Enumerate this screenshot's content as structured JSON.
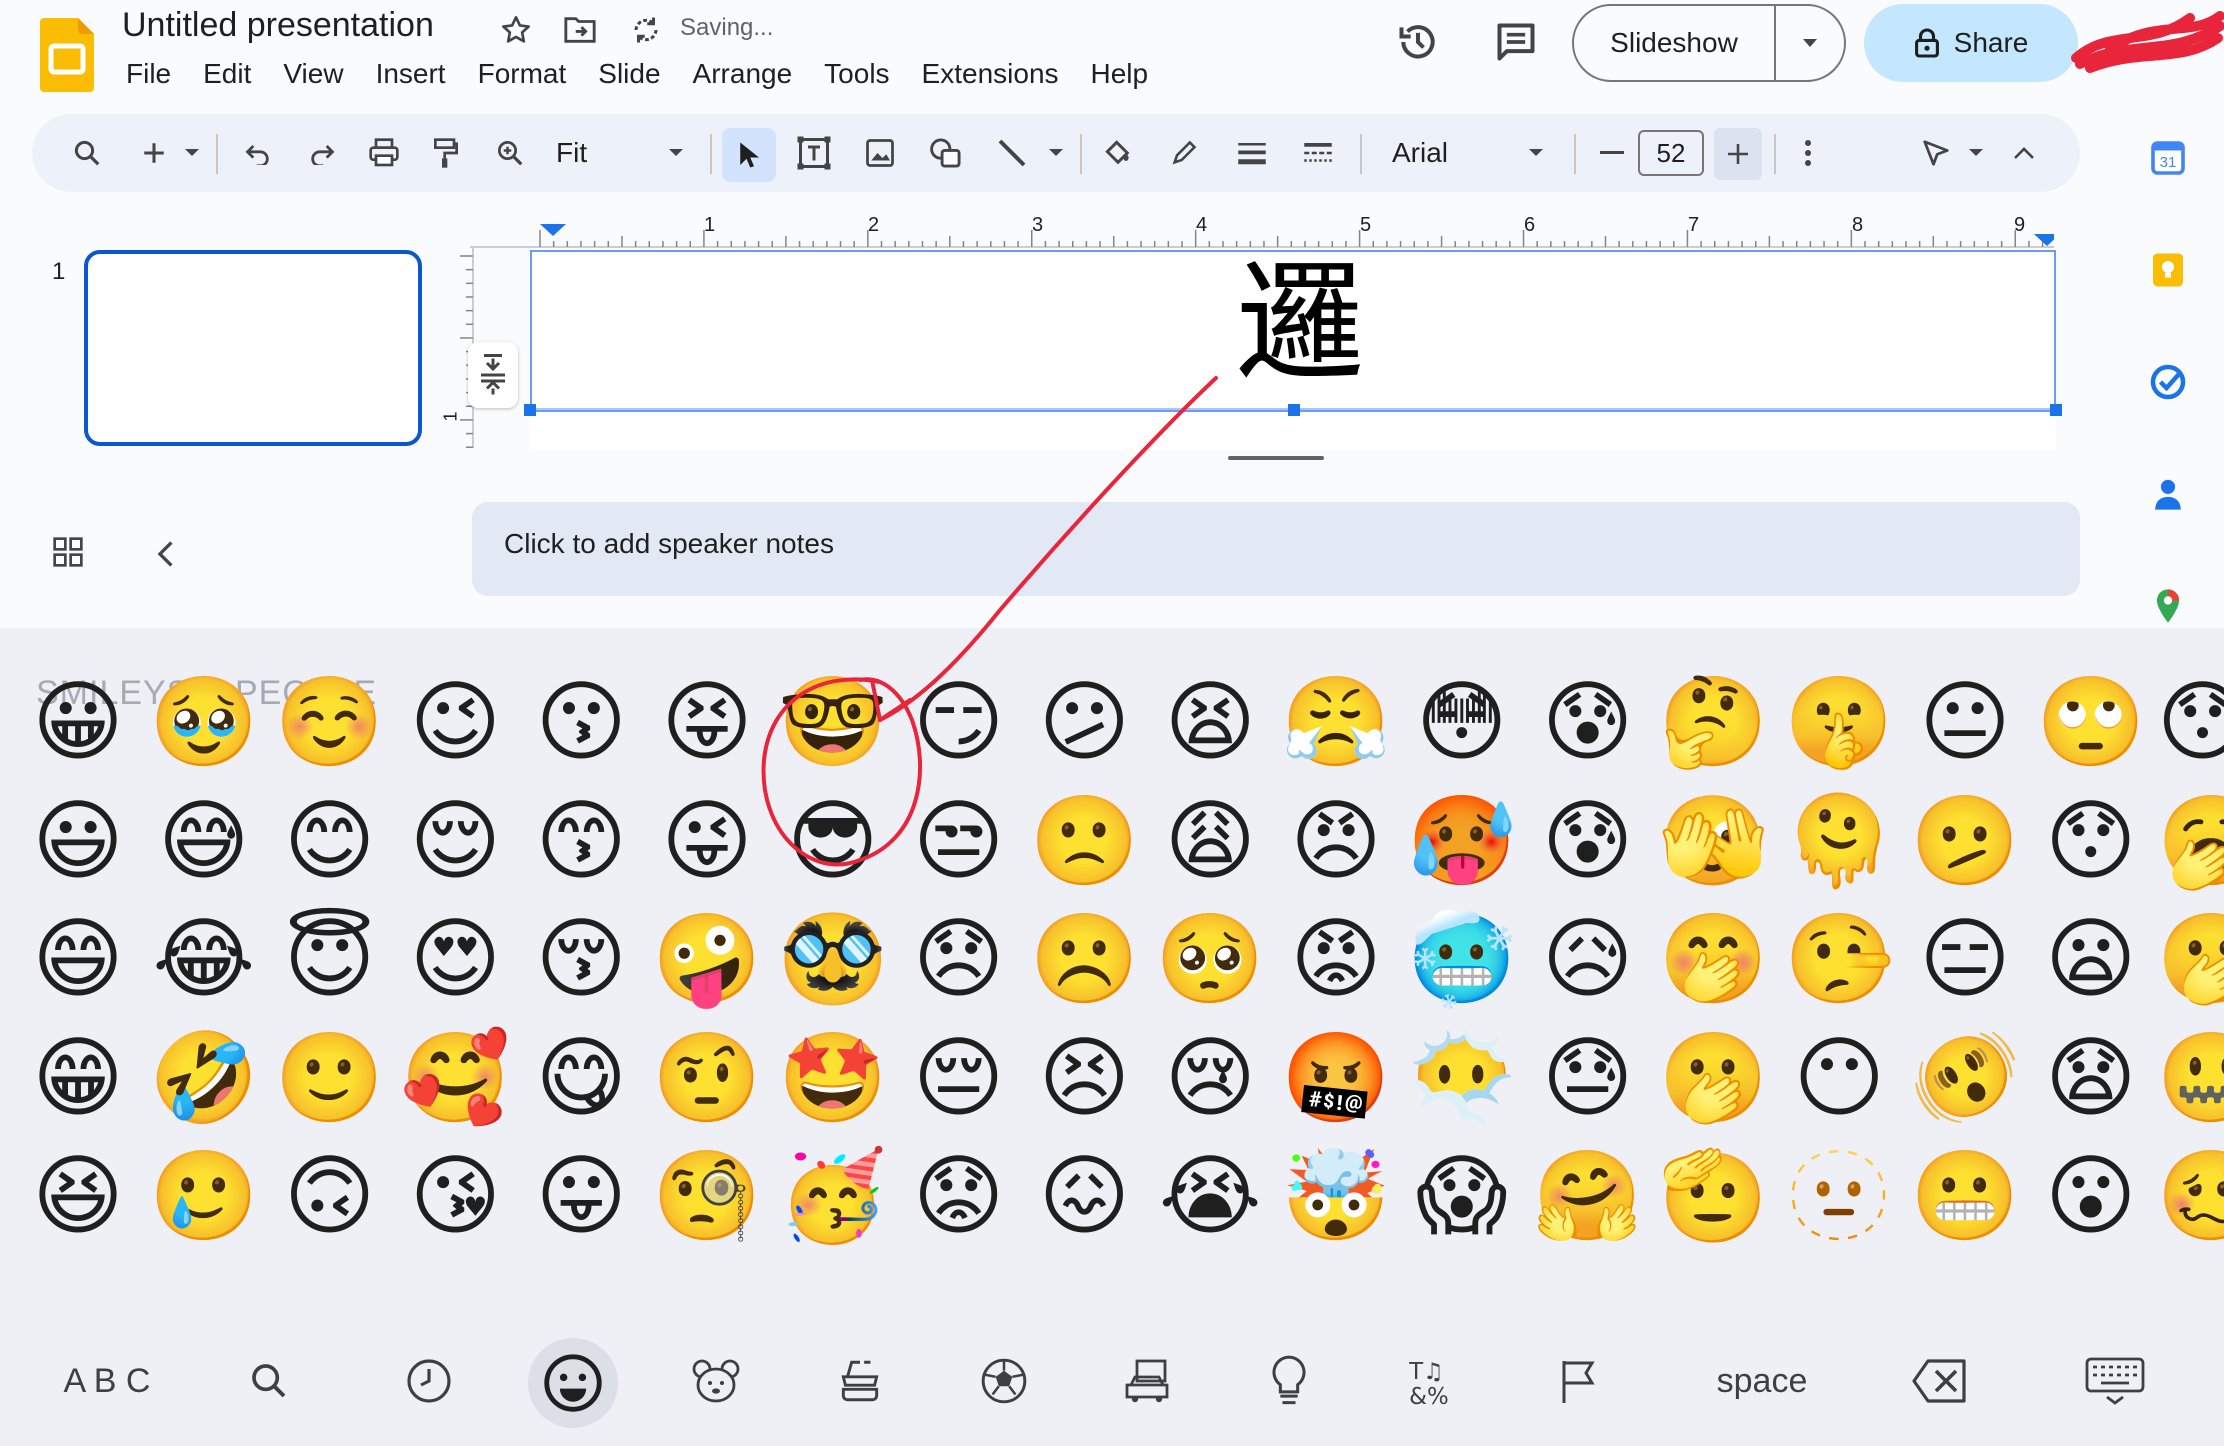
{
  "header": {
    "title": "Untitled presentation",
    "saving": "Saving...",
    "menu": [
      "File",
      "Edit",
      "View",
      "Insert",
      "Format",
      "Slide",
      "Arrange",
      "Tools",
      "Extensions",
      "Help"
    ],
    "slideshow_label": "Slideshow",
    "share_label": "Share"
  },
  "toolbar": {
    "zoom": "Fit",
    "font": "Arial",
    "font_size": "52"
  },
  "ruler": {
    "ticks": [
      "1",
      "2",
      "3",
      "4",
      "5",
      "6",
      "7",
      "8",
      "9"
    ],
    "vtick": "1"
  },
  "slides": {
    "number": "1"
  },
  "slide": {
    "text": "邏"
  },
  "notes": {
    "placeholder": "Click to add speaker notes"
  },
  "keyboard": {
    "section_title": "SMILEYS & PEOPLE",
    "emojis": [
      [
        "😀",
        "🥹",
        "☺️",
        "😉",
        "😗",
        "😝",
        "🤓",
        "😏",
        "😕",
        "😫",
        "😤",
        "😳",
        "😰",
        "🤔",
        "🤫",
        "😐",
        "🙄",
        "😯"
      ],
      [
        "😃",
        "😅",
        "😊",
        "😌",
        "😙",
        "😜",
        "😎",
        "😒",
        "🙁",
        "😩",
        "😠",
        "🥵",
        "😰",
        "🫣",
        "🫠",
        "🫤",
        "😯",
        "🥱"
      ],
      [
        "😄",
        "😂",
        "😇",
        "😍",
        "😚",
        "🤪",
        "🥸",
        "😞",
        "☹️",
        "🥺",
        "😡",
        "🥶",
        "😥",
        "🤭",
        "🤥",
        "😑",
        "😦",
        "🫢"
      ],
      [
        "😁",
        "🤣",
        "🙂",
        "🥰",
        "😋",
        "🤨",
        "🤩",
        "😔",
        "😣",
        "😢",
        "🤬",
        "😶‍🌫️",
        "😓",
        "🫢",
        "😶",
        "🫨",
        "😧",
        "🤐"
      ],
      [
        "😆",
        "🥲",
        "🙃",
        "😘",
        "😛",
        "🧐",
        "🥳",
        "😟",
        "😖",
        "😭",
        "🤯",
        "😱",
        "🤗",
        "🫡",
        "🫥",
        "😬",
        "😮",
        "🥴"
      ]
    ],
    "abc_label": "A B C",
    "space_label": "space"
  },
  "colors": {
    "accent": "#0b57d0",
    "share_bg": "#c2e7ff",
    "annotation": "#e8253a",
    "keyboard_bg": "#eef0f6"
  }
}
